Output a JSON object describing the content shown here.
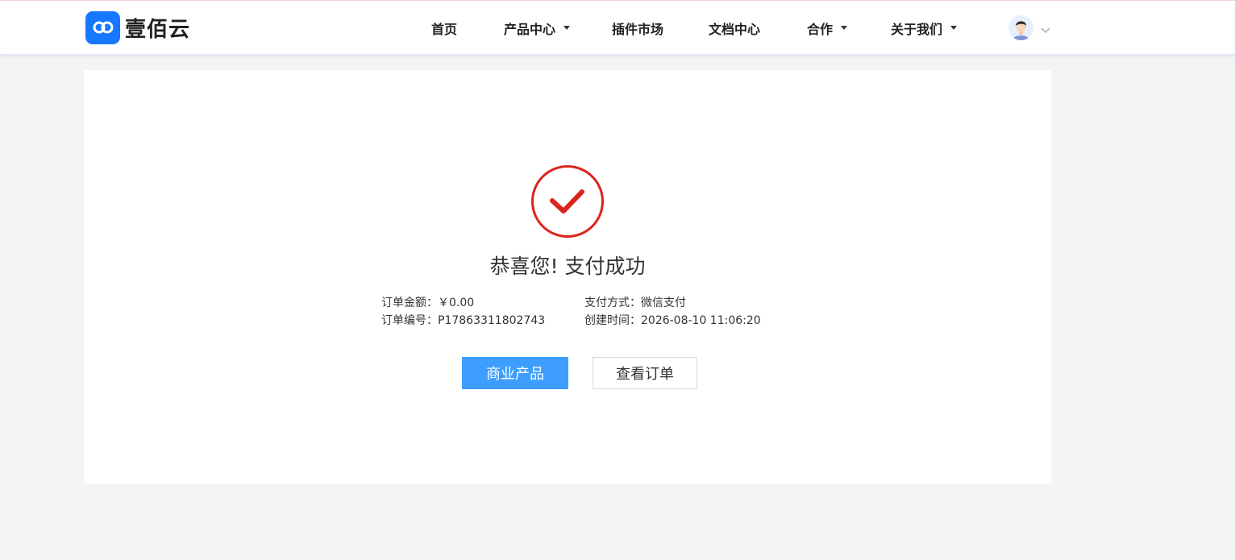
{
  "brand": {
    "name": "壹佰云",
    "color": "#1677ff"
  },
  "nav": {
    "items": [
      {
        "label": "首页",
        "has_dropdown": false
      },
      {
        "label": "产品中心",
        "has_dropdown": true
      },
      {
        "label": "插件市场",
        "has_dropdown": false
      },
      {
        "label": "文档中心",
        "has_dropdown": false
      },
      {
        "label": "合作",
        "has_dropdown": true
      },
      {
        "label": "关于我们",
        "has_dropdown": true
      }
    ],
    "user_icon": "avatar-icon"
  },
  "result": {
    "icon": "check-circle-icon",
    "icon_color": "#d9261c",
    "title": "恭喜您! 支付成功",
    "order_amount_label": "订单金额：",
    "order_amount_value": "￥0.00",
    "payment_method_label": "支付方式：",
    "payment_method_value": "微信支付",
    "order_no_label": "订单编号：",
    "order_no_value": "P17863311802743",
    "created_time_label": "创建时间：",
    "created_time_value": "2026-08-10 11:06:20"
  },
  "actions": {
    "primary_label": "商业产品",
    "secondary_label": "查看订单",
    "primary_color": "#3d9eff"
  }
}
